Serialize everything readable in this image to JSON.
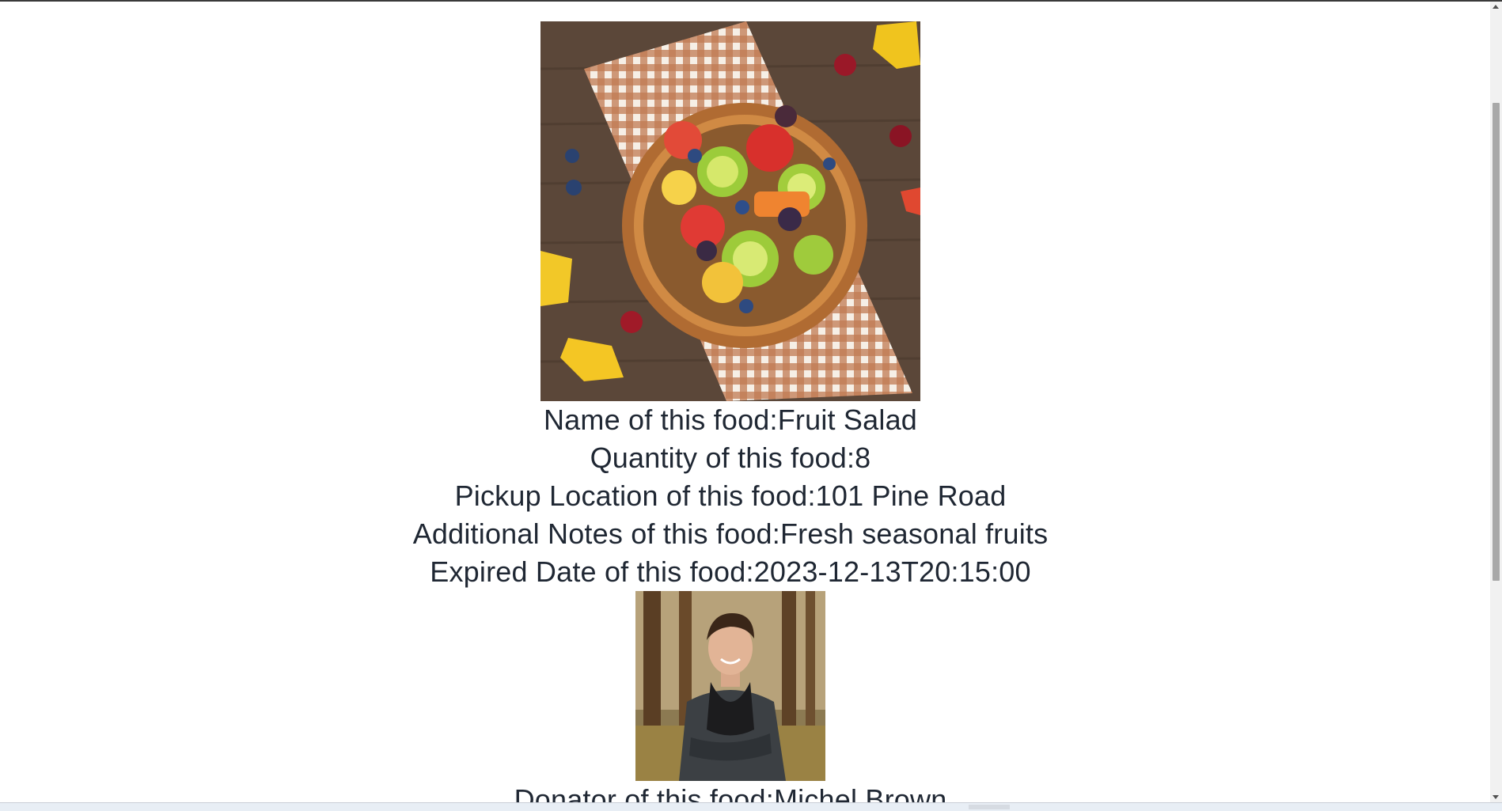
{
  "food": {
    "image_alt": "Fruit salad in a wooden bowl",
    "name_line": "Name of this food:Fruit Salad",
    "quantity_line": "Quantity of this food:8",
    "location_line": "Pickup Location of this food:101 Pine Road",
    "notes_line": "Additional Notes of this food:Fresh seasonal fruits",
    "expired_line": "Expired Date of this food:2023-12-13T20:15:00"
  },
  "donator": {
    "image_alt": "Donator photo",
    "name_line": "Donator of this food:Michel Brown"
  }
}
